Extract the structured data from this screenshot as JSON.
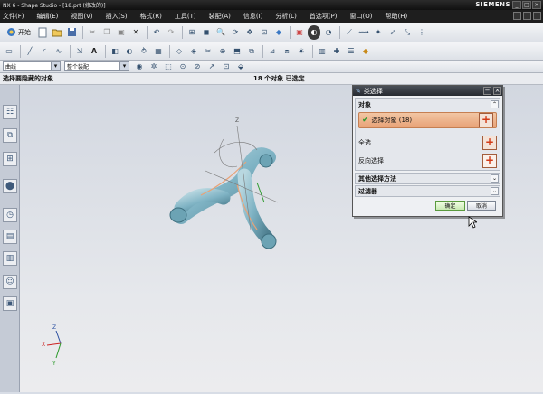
{
  "window": {
    "title": "NX 6 - Shape Studio - [18.prt (修改的)]",
    "brand": "SIEMENS"
  },
  "menu": [
    {
      "label": "文件(F)"
    },
    {
      "label": "编辑(E)"
    },
    {
      "label": "视图(V)"
    },
    {
      "label": "插入(S)"
    },
    {
      "label": "格式(R)"
    },
    {
      "label": "工具(T)"
    },
    {
      "label": "装配(A)"
    },
    {
      "label": "信息(I)"
    },
    {
      "label": "分析(L)"
    },
    {
      "label": "首选项(P)"
    },
    {
      "label": "窗口(O)"
    },
    {
      "label": "帮助(H)"
    }
  ],
  "toolbar": {
    "start_label": "开始",
    "filter_value": "曲线",
    "scope_value": "整个装配"
  },
  "cue_line": {
    "message": "选择要隐藏的对象",
    "status": "18 个对象 已选定"
  },
  "dialog": {
    "title": "类选择",
    "objects_group": "对象",
    "select_objects_label": "选择对象 (18)",
    "select_all_label": "全选",
    "invert_label": "反向选择",
    "other_methods_label": "其他选择方法",
    "filter_label": "过滤器",
    "ok_label": "确定",
    "cancel_label": "取消"
  },
  "colors": {
    "accent": "#e8a277",
    "model": "#7fb3c4"
  },
  "icons": [
    "start-icon",
    "new-icon",
    "open-icon",
    "save-icon",
    "undo-icon",
    "redo-icon",
    "cut-icon",
    "copy-icon",
    "paste-icon",
    "delete-icon",
    "fit-icon",
    "shaded-icon",
    "wireframe-icon",
    "rotate-icon",
    "zoom-icon",
    "pan-icon",
    "hide-icon",
    "show-icon",
    "plus-cross-icon",
    "check-icon"
  ]
}
